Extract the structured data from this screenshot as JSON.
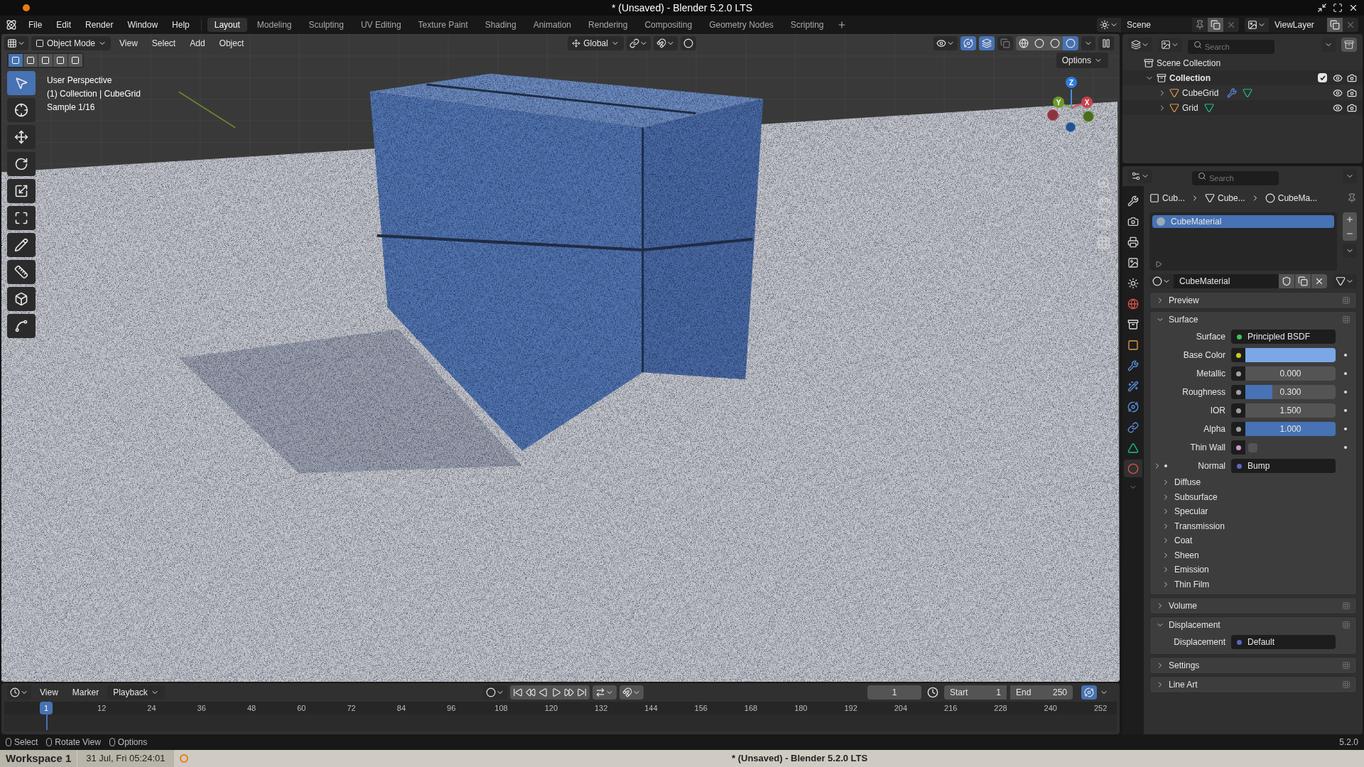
{
  "os_titlebar": {
    "title": "* (Unsaved) - Blender 5.2.0 LTS"
  },
  "topbar": {
    "menus": [
      "File",
      "Edit",
      "Render",
      "Window",
      "Help"
    ],
    "workspace_tabs": [
      {
        "label": "Layout",
        "selected": true
      },
      {
        "label": "Modeling",
        "selected": false
      },
      {
        "label": "Sculpting",
        "selected": false
      },
      {
        "label": "UV Editing",
        "selected": false
      },
      {
        "label": "Texture Paint",
        "selected": false
      },
      {
        "label": "Shading",
        "selected": false
      },
      {
        "label": "Animation",
        "selected": false
      },
      {
        "label": "Rendering",
        "selected": false
      },
      {
        "label": "Compositing",
        "selected": false
      },
      {
        "label": "Geometry Nodes",
        "selected": false
      },
      {
        "label": "Scripting",
        "selected": false
      }
    ],
    "scene": "Scene",
    "view_layer": "ViewLayer"
  },
  "viewport": {
    "mode": "Object Mode",
    "menus": [
      "View",
      "Select",
      "Add",
      "Object"
    ],
    "orientation": "Global",
    "options": "Options",
    "select_modes": [
      {
        "selected": true
      },
      {
        "selected": false
      },
      {
        "selected": false
      },
      {
        "selected": false
      },
      {
        "selected": false
      }
    ],
    "shading": [
      {
        "kind": "wireframe",
        "selected": false
      },
      {
        "kind": "solid",
        "selected": false
      },
      {
        "kind": "material",
        "selected": false
      },
      {
        "kind": "rendered",
        "selected": true
      }
    ],
    "overlay_lines": [
      "User Perspective",
      "(1) Collection | CubeGrid",
      "Sample 1/16"
    ],
    "tools": [
      {
        "kind": "select",
        "selected": true
      },
      {
        "kind": "cursor",
        "selected": false
      },
      {
        "kind": "move",
        "selected": false
      },
      {
        "kind": "rotate",
        "selected": false
      },
      {
        "kind": "scale",
        "selected": false
      },
      {
        "kind": "transform",
        "selected": false
      },
      {
        "kind": "annotate",
        "selected": false
      },
      {
        "kind": "measure",
        "selected": false
      },
      {
        "kind": "add-cube",
        "selected": false
      },
      {
        "kind": "extrude",
        "selected": false
      }
    ],
    "axes": [
      "Z",
      "Y",
      "X"
    ]
  },
  "outliner": {
    "search_placeholder": "Search",
    "tree": [
      {
        "label": "Scene Collection",
        "children": [
          {
            "label": "Collection",
            "expanded": true,
            "checked": true,
            "children": [
              {
                "label": "CubeGrid",
                "expanded": false
              },
              {
                "label": "Grid",
                "expanded": false
              }
            ]
          }
        ]
      }
    ]
  },
  "properties": {
    "search_placeholder": "Search",
    "tabs": [
      {
        "kind": "tool",
        "selected": false
      },
      {
        "kind": "render",
        "selected": false
      },
      {
        "kind": "output",
        "selected": false
      },
      {
        "kind": "view-layer",
        "selected": false
      },
      {
        "kind": "scene",
        "selected": false
      },
      {
        "kind": "world",
        "selected": false
      },
      {
        "kind": "collection",
        "selected": false
      },
      {
        "kind": "object",
        "selected": false
      },
      {
        "kind": "modifier",
        "selected": false
      },
      {
        "kind": "particles",
        "selected": false
      },
      {
        "kind": "physics",
        "selected": false
      },
      {
        "kind": "constraints",
        "selected": false
      },
      {
        "kind": "data",
        "selected": false
      },
      {
        "kind": "material",
        "selected": true
      }
    ],
    "breadcrumb": [
      "Cub...",
      "Cube...",
      "CubeMa..."
    ],
    "material_slots": [
      {
        "label": "CubeMaterial",
        "selected": true
      }
    ],
    "material_name": "CubeMaterial",
    "panels": [
      {
        "title": "Preview",
        "expanded": false
      },
      {
        "title": "Surface",
        "expanded": true,
        "fields": [
          {
            "kind": "link",
            "label": "Surface",
            "value": "Principled BSDF",
            "color": "#3ec25a"
          },
          {
            "kind": "color",
            "label": "Base Color",
            "color": "#c7c729"
          },
          {
            "kind": "number",
            "label": "Metallic",
            "value": "0.000",
            "color": "#a1a1a1"
          },
          {
            "kind": "slider",
            "label": "Roughness",
            "value": "0.300",
            "level": 0.3,
            "color": "#a1a1a1"
          },
          {
            "kind": "number",
            "label": "IOR",
            "value": "1.500",
            "color": "#a1a1a1"
          },
          {
            "kind": "slider",
            "label": "Alpha",
            "value": "1.000",
            "level": 1,
            "color": "#a1a1a1"
          },
          {
            "kind": "checkbox",
            "label": "Thin Wall",
            "checked": false,
            "color": "#cc99cc"
          },
          {
            "kind": "link",
            "label": "Normal",
            "value": "Bump",
            "color": "#6363c7",
            "expandable": true
          }
        ],
        "subpanels": [
          {
            "title": "Diffuse",
            "expanded": false
          },
          {
            "title": "Subsurface",
            "expanded": false
          },
          {
            "title": "Specular",
            "expanded": false
          },
          {
            "title": "Transmission",
            "expanded": false
          },
          {
            "title": "Coat",
            "expanded": false
          },
          {
            "title": "Sheen",
            "expanded": false
          },
          {
            "title": "Emission",
            "expanded": false
          },
          {
            "title": "Thin Film",
            "expanded": false
          }
        ]
      },
      {
        "title": "Volume",
        "expanded": false
      },
      {
        "title": "Displacement",
        "expanded": true,
        "fields": [
          {
            "kind": "link",
            "label": "Displacement",
            "value": "Default",
            "color": "#6363c7"
          }
        ]
      },
      {
        "title": "Settings",
        "expanded": false
      },
      {
        "title": "Line Art",
        "expanded": false
      }
    ]
  },
  "timeline": {
    "menus": [
      "View",
      "Marker"
    ],
    "playback": "Playback",
    "current_frame": "1",
    "start_label": "Start",
    "start": "1",
    "end_label": "End",
    "end": "250",
    "playhead": "1",
    "ticks": [
      "12",
      "24",
      "36",
      "48",
      "60",
      "72",
      "84",
      "96",
      "108",
      "120",
      "132",
      "144",
      "156",
      "168",
      "180",
      "192",
      "204",
      "216",
      "228",
      "240",
      "252"
    ]
  },
  "status_bar": {
    "hints": [
      "Select",
      "Rotate View",
      "Options"
    ],
    "version": "5.2.0"
  },
  "taskbar": {
    "workspace": "Workspace 1",
    "datetime": "31 Jul, Fri 05:24:01",
    "title": "* (Unsaved) - Blender 5.2.0 LTS"
  }
}
